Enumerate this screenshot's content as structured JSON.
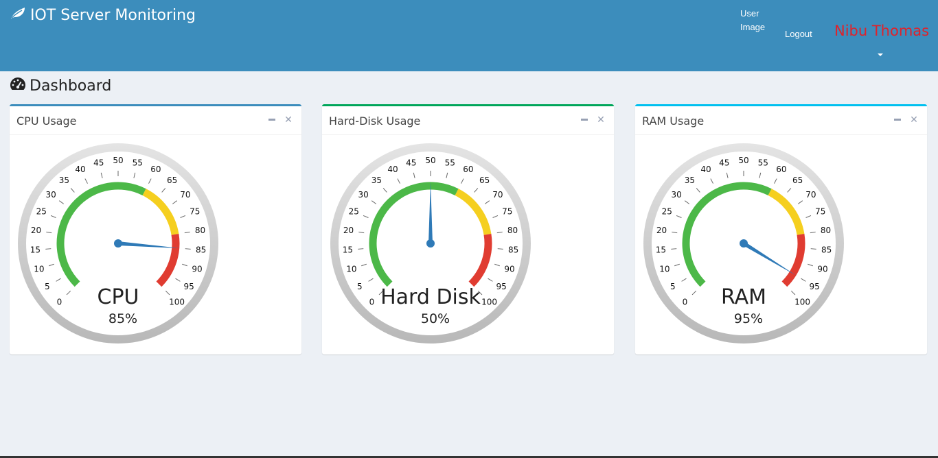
{
  "header": {
    "brand": "IOT Server Monitoring",
    "user_image_alt": "User Image",
    "logout": "Logout",
    "username": "Nibu Thomas",
    "colors": {
      "bar": "#3c8dbc",
      "username": "#e0222a"
    }
  },
  "page": {
    "title": "Dashboard"
  },
  "panels": [
    {
      "title": "CPU Usage",
      "gauge_label": "CPU",
      "value": 85,
      "value_text": "85%",
      "accent": "#3c8dbc"
    },
    {
      "title": "Hard-Disk Usage",
      "gauge_label": "Hard Disk",
      "value": 50,
      "value_text": "50%",
      "accent": "#00a65a"
    },
    {
      "title": "RAM Usage",
      "gauge_label": "RAM",
      "value": 95,
      "value_text": "95%",
      "accent": "#00c0ef"
    }
  ],
  "gauge": {
    "min": 0,
    "max": 100,
    "ticks": [
      "0",
      "5",
      "10",
      "15",
      "20",
      "25",
      "30",
      "35",
      "40",
      "45",
      "50",
      "55",
      "60",
      "65",
      "70",
      "75",
      "80",
      "85",
      "90",
      "95",
      "100"
    ],
    "bands": [
      {
        "from": 0,
        "to": 60,
        "color": "#4cb848"
      },
      {
        "from": 60,
        "to": 80,
        "color": "#f5cf1f"
      },
      {
        "from": 80,
        "to": 100,
        "color": "#e03c31"
      }
    ],
    "needle_color": "#2f7ab7"
  }
}
